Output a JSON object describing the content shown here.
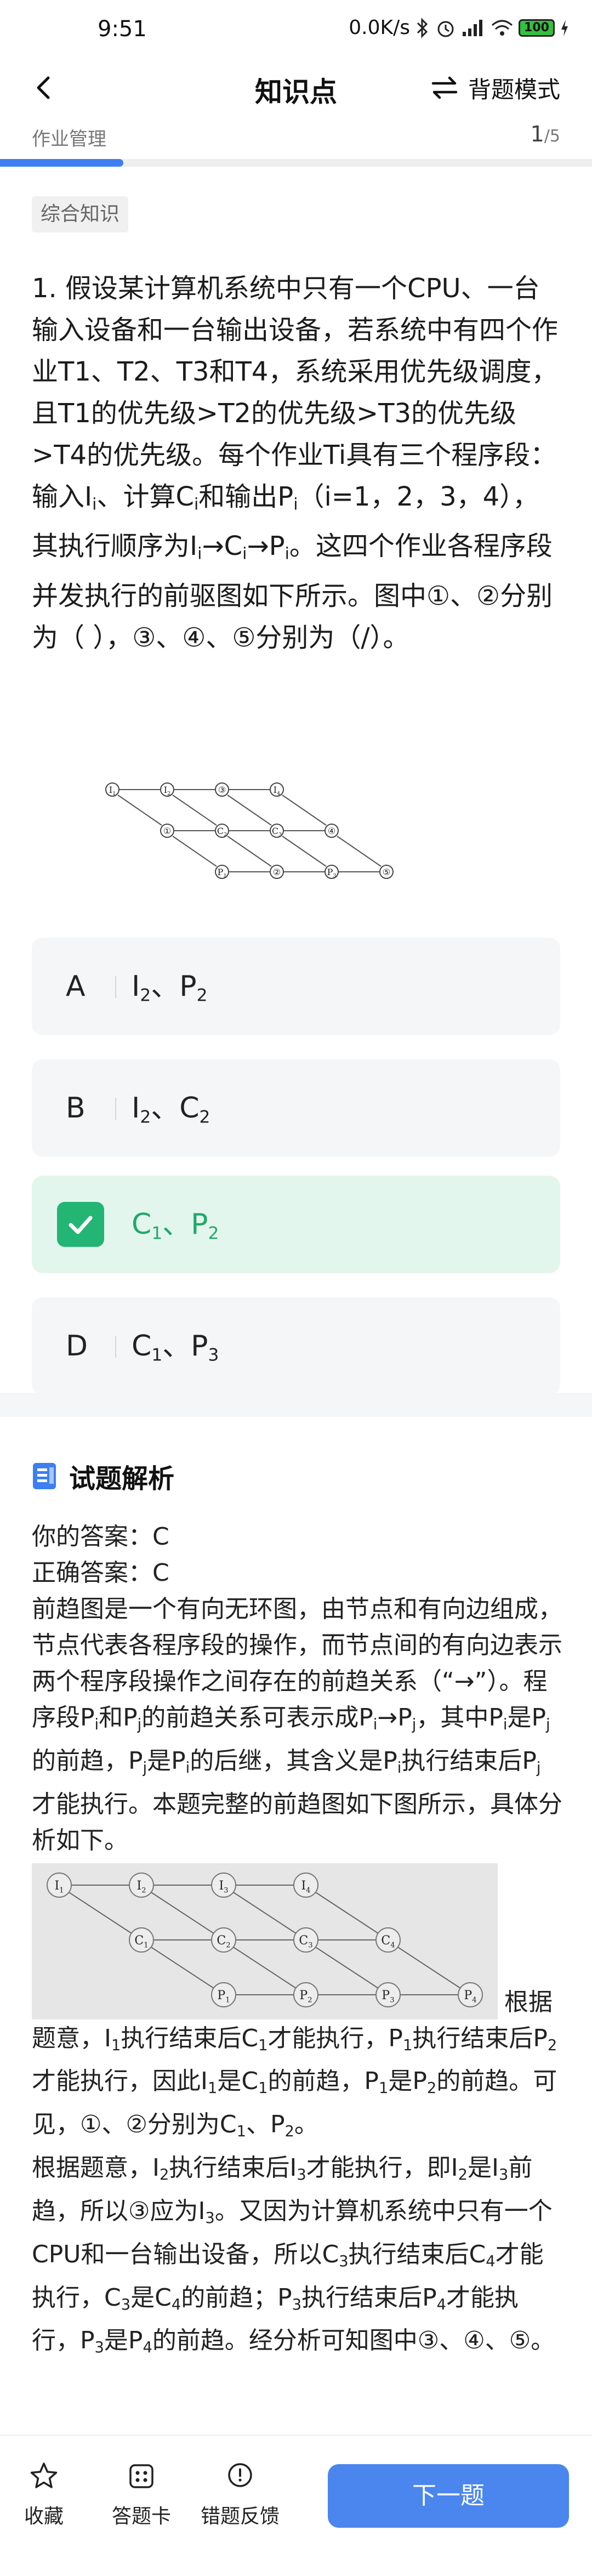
{
  "status_bar": {
    "time": "9:51",
    "speed": "0.0K/s",
    "battery": "100"
  },
  "header": {
    "title": "知识点",
    "mode_label": "背题模式"
  },
  "progress": {
    "homework_label": "作业管理",
    "current": "1",
    "total": "/5",
    "fraction": 0.2
  },
  "tag": "综合知识",
  "question": {
    "p1": "1. 假设某计算机系统中只有一个CPU、一台输入设备和一台输出设备，若系统中有四个作业T1、T2、T3和T4，系统采用优先级调度，且T1的优先级>T2的优先级>T3的优先级>T4的优先级。每个作业Ti具有三个程序段：输入I",
    "p2": "、计算C",
    "p3": "和输出P",
    "p4": "（i=1，2，3，4），其执行顺序为I",
    "p5": "→C",
    "p6": "→P",
    "p7": "。这四个作业各程序段并发执行的前驱图如下所示。图中①、②分别为（ ），③、④、⑤分别为（/）。",
    "sub_i": "i",
    "fig": {
      "top": [
        "I1",
        "I2",
        "③",
        "I4"
      ],
      "mid": [
        "①",
        "C2",
        "C3",
        "④"
      ],
      "bot": [
        "P1",
        "②",
        "P3",
        "⑤"
      ]
    }
  },
  "options": [
    {
      "letter": "A",
      "a": "I",
      "a_sub": "2",
      "sep": "、",
      "b": "P",
      "b_sub": "2"
    },
    {
      "letter": "B",
      "a": "I",
      "a_sub": "2",
      "sep": "、",
      "b": "C",
      "b_sub": "2"
    },
    {
      "letter": "C",
      "a": "C",
      "a_sub": "1",
      "sep": "、",
      "b": "P",
      "b_sub": "2"
    },
    {
      "letter": "D",
      "a": "C",
      "a_sub": "1",
      "sep": "、",
      "b": "P",
      "b_sub": "3"
    }
  ],
  "analysis": {
    "title": "试题解析",
    "your_answer": "你的答案：C",
    "correct_answer": "正确答案：C",
    "t1": "前趋图是一个有向无环图，由节点和有向边组成，节点代表各程序段的操作，而节点间的有向边表示两个程序段操作之间存在的前趋关系（“→”）。程序段P",
    "t2": "和P",
    "t3": "的前趋关系可表示成P",
    "t4": "→P",
    "t5": "，其中P",
    "t6": "是P",
    "t7": "的前趋，P",
    "t8": "是P",
    "t9": "的后继，其含义是P",
    "t10": "执行结束后P",
    "t11": "才能执行。本题完整的前趋图如下图所示，具体分析如下。",
    "sub_i": "i",
    "sub_j": "j",
    "fig": {
      "top": [
        "I1",
        "I2",
        "I3",
        "I4"
      ],
      "mid": [
        "C1",
        "C2",
        "C3",
        "C4"
      ],
      "bot": [
        "P1",
        "P2",
        "P3",
        "P4"
      ]
    },
    "r1": "根据题意，I",
    "r2": "执行结束后C",
    "r3": "才能执行，P",
    "r4": "执行结束后P",
    "r5": "才能执行，因此I",
    "r6": "是C",
    "r7": "的前趋，P",
    "r8": "是P",
    "r9": "的前趋。可见，①、②分别为C",
    "r10": "、P",
    "r11": "。",
    "s1": "根据题意，I",
    "s2": "执行结束后I",
    "s3": "才能执行，即I",
    "s4": "是I",
    "s5": "前趋，所以③应为I",
    "s6": "。又因为计算机系统中只有一个CPU和一台输出设备，所以C",
    "s7": "执行结束后C",
    "s8": "才能执行，C",
    "s9": "是C",
    "s10": "的前趋；P",
    "s11": "执行结束后P",
    "s12": "才能执行，P",
    "s13": "是P",
    "s14": "的前趋。经分析可知图中③、④、⑤。",
    "n1": "1",
    "n2": "2",
    "n3": "3",
    "n4": "4"
  },
  "bottom": {
    "favorite": "收藏",
    "answer_card": "答题卡",
    "feedback": "错题反馈",
    "next": "下一题"
  },
  "colors": {
    "accent": "#4a86ee",
    "correct": "#22b573",
    "correct_bg": "#e3f6ed"
  }
}
